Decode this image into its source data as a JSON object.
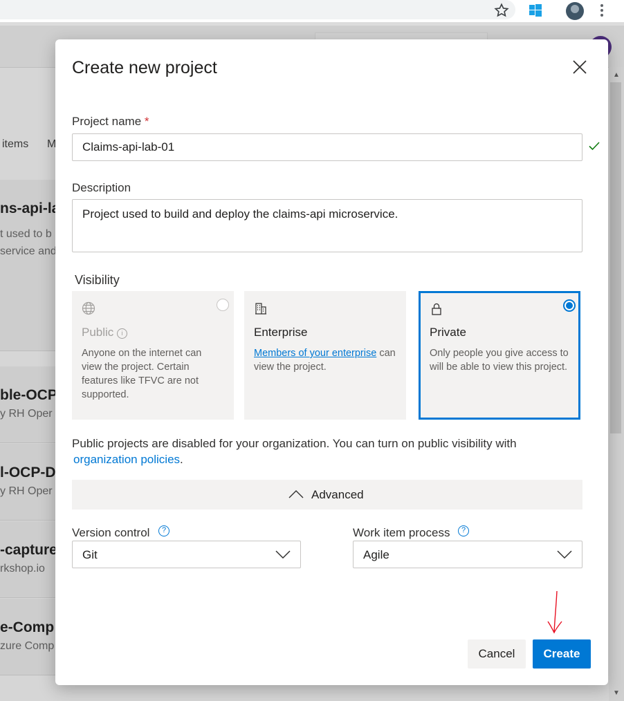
{
  "browser": {
    "star_icon": "star-icon",
    "windows_icon": "windows-icon",
    "profile_icon": "profile-icon",
    "menu_icon": "kebab-menu-icon"
  },
  "background": {
    "tab_items": "items",
    "tab_next": "M",
    "cards": [
      {
        "title": "ns-api-la",
        "line1": "t used to b",
        "line2": "service and"
      },
      {
        "title": "ble-OCP",
        "line1": "y RH Oper",
        "line2": ""
      },
      {
        "title": "l-OCP-D",
        "line1": "y RH Oper",
        "line2": ""
      },
      {
        "title": "-capture",
        "line1": "rkshop.io",
        "line2": ""
      },
      {
        "title": "e-Comp",
        "line1": "zure Comp",
        "line2": ""
      }
    ]
  },
  "dialog": {
    "title": "Create new project",
    "project_name_label": "Project name",
    "required_mark": "*",
    "project_name_value": "Claims-api-lab-01",
    "description_label": "Description",
    "description_value": "Project used to build and deploy the claims-api microservice.",
    "visibility_label": "Visibility",
    "visibility_options": [
      {
        "title": "Public",
        "desc": "Anyone on the internet can view the project. Certain features like TFVC are not supported.",
        "disabled": true
      },
      {
        "title": "Enterprise",
        "link": "Members of your enterprise",
        "desc_rest": " can view the project."
      },
      {
        "title": "Private",
        "desc": "Only people you give access to will be able to view this project.",
        "selected": true
      }
    ],
    "public_notice": "Public projects are disabled for your organization. You can turn on public visibility with",
    "public_notice_link": "organization policies",
    "public_notice_end": ".",
    "advanced_label": "Advanced",
    "version_control_label": "Version control",
    "version_control_value": "Git",
    "work_item_label": "Work item process",
    "work_item_value": "Agile",
    "cancel_label": "Cancel",
    "create_label": "Create"
  },
  "colors": {
    "accent": "#0078d4",
    "required": "#d13438",
    "success": "#107c10",
    "annotation": "#e81123"
  }
}
